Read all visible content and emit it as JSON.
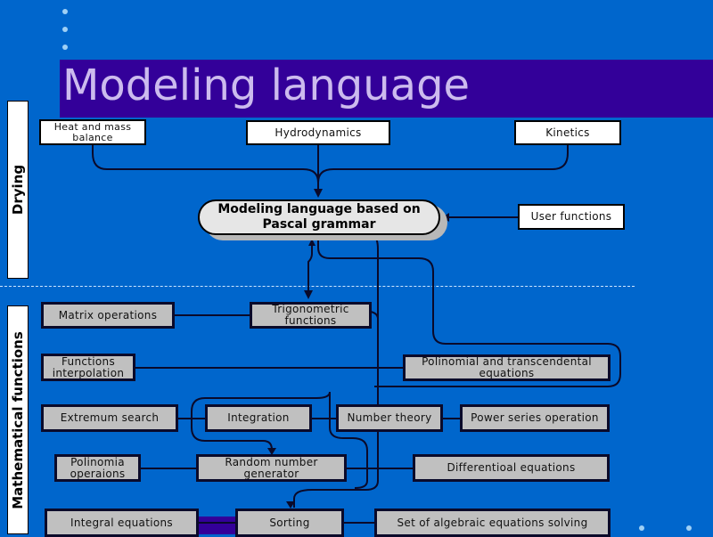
{
  "slide": {
    "title": "Modeling language",
    "colors": {
      "background": "#0066cc",
      "title_bar": "#330099",
      "title_text": "#ccbbee",
      "box_grey": "#c0c0c0",
      "box_white": "#ffffff",
      "line": "#0a0a2a"
    }
  },
  "sections": {
    "drying": "Drying",
    "math": "Mathematical functions"
  },
  "central_node": {
    "line1": "Modeling language based on",
    "line2": "Pascal grammar"
  },
  "drying_nodes": {
    "heat": "Heat and mass balance",
    "hydro": "Hydrodynamics",
    "kinetics": "Kinetics",
    "user": "User functions"
  },
  "math_nodes": {
    "matrix": "Matrix operations",
    "trig": "Trigonometric functions",
    "interp": "Functions interpolation",
    "polytrans": "Polinomial and transcendental equations",
    "extremum": "Extremum search",
    "integration": "Integration",
    "number": "Number theory",
    "power": "Power series operation",
    "polyops": "Polinomia operaions",
    "random": "Random number generator",
    "diffeq": "Differentioal equations",
    "integral": "Integral equations",
    "sorting": "Sorting",
    "algebraic": "Set of algebraic equations solving"
  }
}
